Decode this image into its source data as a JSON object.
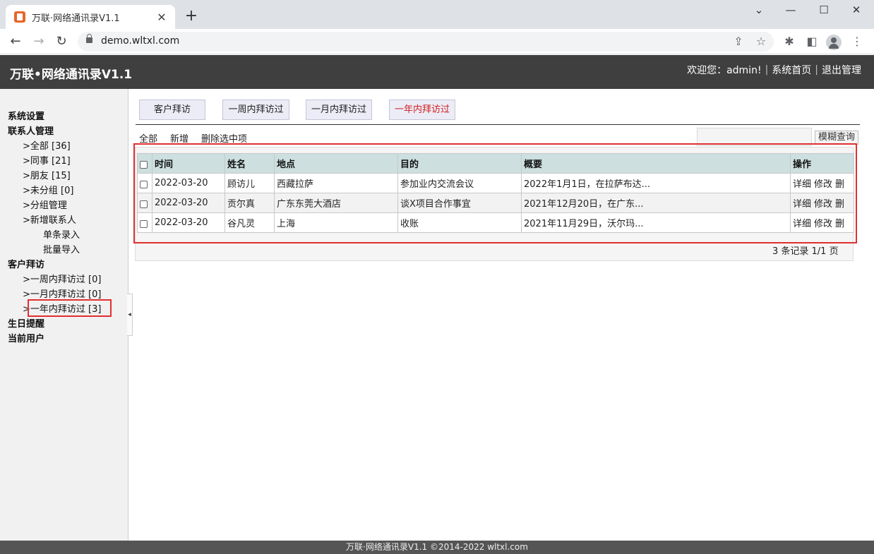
{
  "browser": {
    "tab_title": "万联·网络通讯录V1.1",
    "tab_close": "✕",
    "new_tab": "+",
    "url": "demo.wltxl.com"
  },
  "header": {
    "app_title": "万联•网络通讯录V1.1",
    "welcome": "欢迎您：admin!",
    "home_link": "系统首页",
    "logout_link": "退出管理",
    "separator": "|"
  },
  "sidebar": {
    "items": [
      {
        "label": "系统设置"
      },
      {
        "label": "联系人管理"
      },
      {
        "label": ">全部 [36]"
      },
      {
        "label": ">同事 [21]"
      },
      {
        "label": ">朋友 [15]"
      },
      {
        "label": ">未分组 [0]"
      },
      {
        "label": ">分组管理"
      },
      {
        "label": ">新增联系人"
      },
      {
        "label": "单条录入"
      },
      {
        "label": "批量导入"
      },
      {
        "label": "客户拜访"
      },
      {
        "label": ">一周内拜访过 [0]"
      },
      {
        "label": ">一月内拜访过 [0]"
      },
      {
        "label": ">一年内拜访过 [3]"
      },
      {
        "label": "生日提醒"
      },
      {
        "label": "当前用户"
      }
    ],
    "collapse_icon": "◂"
  },
  "main": {
    "tabs": [
      {
        "label": "客户拜访"
      },
      {
        "label": "一周内拜访过"
      },
      {
        "label": "一月内拜访过"
      },
      {
        "label": "一年内拜访过"
      }
    ],
    "toolbar": {
      "all": "全部",
      "add": "新增",
      "delete_selected": "删除选中项"
    },
    "search": {
      "value": "",
      "button": "模糊查询"
    },
    "table": {
      "columns": [
        "时间",
        "姓名",
        "地点",
        "目的",
        "概要",
        "操作"
      ],
      "rows": [
        {
          "time": "2022-03-20",
          "name": "顾访儿",
          "place": "西藏拉萨",
          "purpose": "参加业内交流会议",
          "summary": "2022年1月1日，在拉萨布达..."
        },
        {
          "time": "2022-03-20",
          "name": "贡尔真",
          "place": "广东东莞大酒店",
          "purpose": "谈X项目合作事宜",
          "summary": "2021年12月20日，在广东..."
        },
        {
          "time": "2022-03-20",
          "name": "谷凡灵",
          "place": "上海",
          "purpose": "收账",
          "summary": "2021年11月29日，沃尔玛..."
        }
      ],
      "actions": {
        "detail": "详细",
        "edit": "修改",
        "delete": "删"
      }
    },
    "pager": "3 条记录 1/1 页"
  },
  "footer": {
    "text": "万联·网络通讯录V1.1 ©2014-2022 wltxl.com"
  },
  "colors": {
    "header_bg": "#3f3f3f",
    "active_tab": "#d02020",
    "highlight": "#e03030",
    "table_header_bg": "#cddfdf"
  }
}
